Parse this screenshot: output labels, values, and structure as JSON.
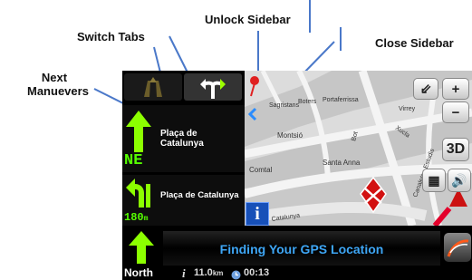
{
  "callouts": {
    "next_manuevers_line1": "Next",
    "next_manuevers_line2": "Manuevers",
    "switch_tabs": "Switch Tabs",
    "unlock_sidebar": "Unlock Sidebar",
    "close_sidebar": "Close Sidebar"
  },
  "maneuvers": [
    {
      "street_line1": "Plaça de",
      "street_line2": "Catalunya",
      "direction": "NE",
      "icon": "straight-arrow-icon"
    },
    {
      "street": "Plaça de Catalunya",
      "distance": "180",
      "distance_unit": "m",
      "icon": "keep-left-arrow-icon"
    }
  ],
  "map": {
    "streets": [
      "Sagristans",
      "Boters",
      "Portaferrissa",
      "Montsió",
      "Comtal",
      "Santa Anna",
      "Canaletes Estudis",
      "Catalunya",
      "Xucla",
      "Virrey",
      "Bot"
    ],
    "zoom_button_label": "3D",
    "colors": {
      "map_bg": "#dcdcdc",
      "block": "#c4c4c4",
      "road": "#f2f2f2",
      "route_blue": "#1e5fd0",
      "vehicle_red": "#d21111"
    }
  },
  "bottom": {
    "status_text": "Finding Your GPS Location",
    "heading": "North",
    "distance_value": "11.0",
    "distance_unit": "km",
    "eta": "00:13"
  },
  "colors": {
    "accent_green": "#8cff00",
    "text_blue": "#3ea6f5",
    "pin_red": "#e02020",
    "chevron_blue": "#2a8cff"
  }
}
